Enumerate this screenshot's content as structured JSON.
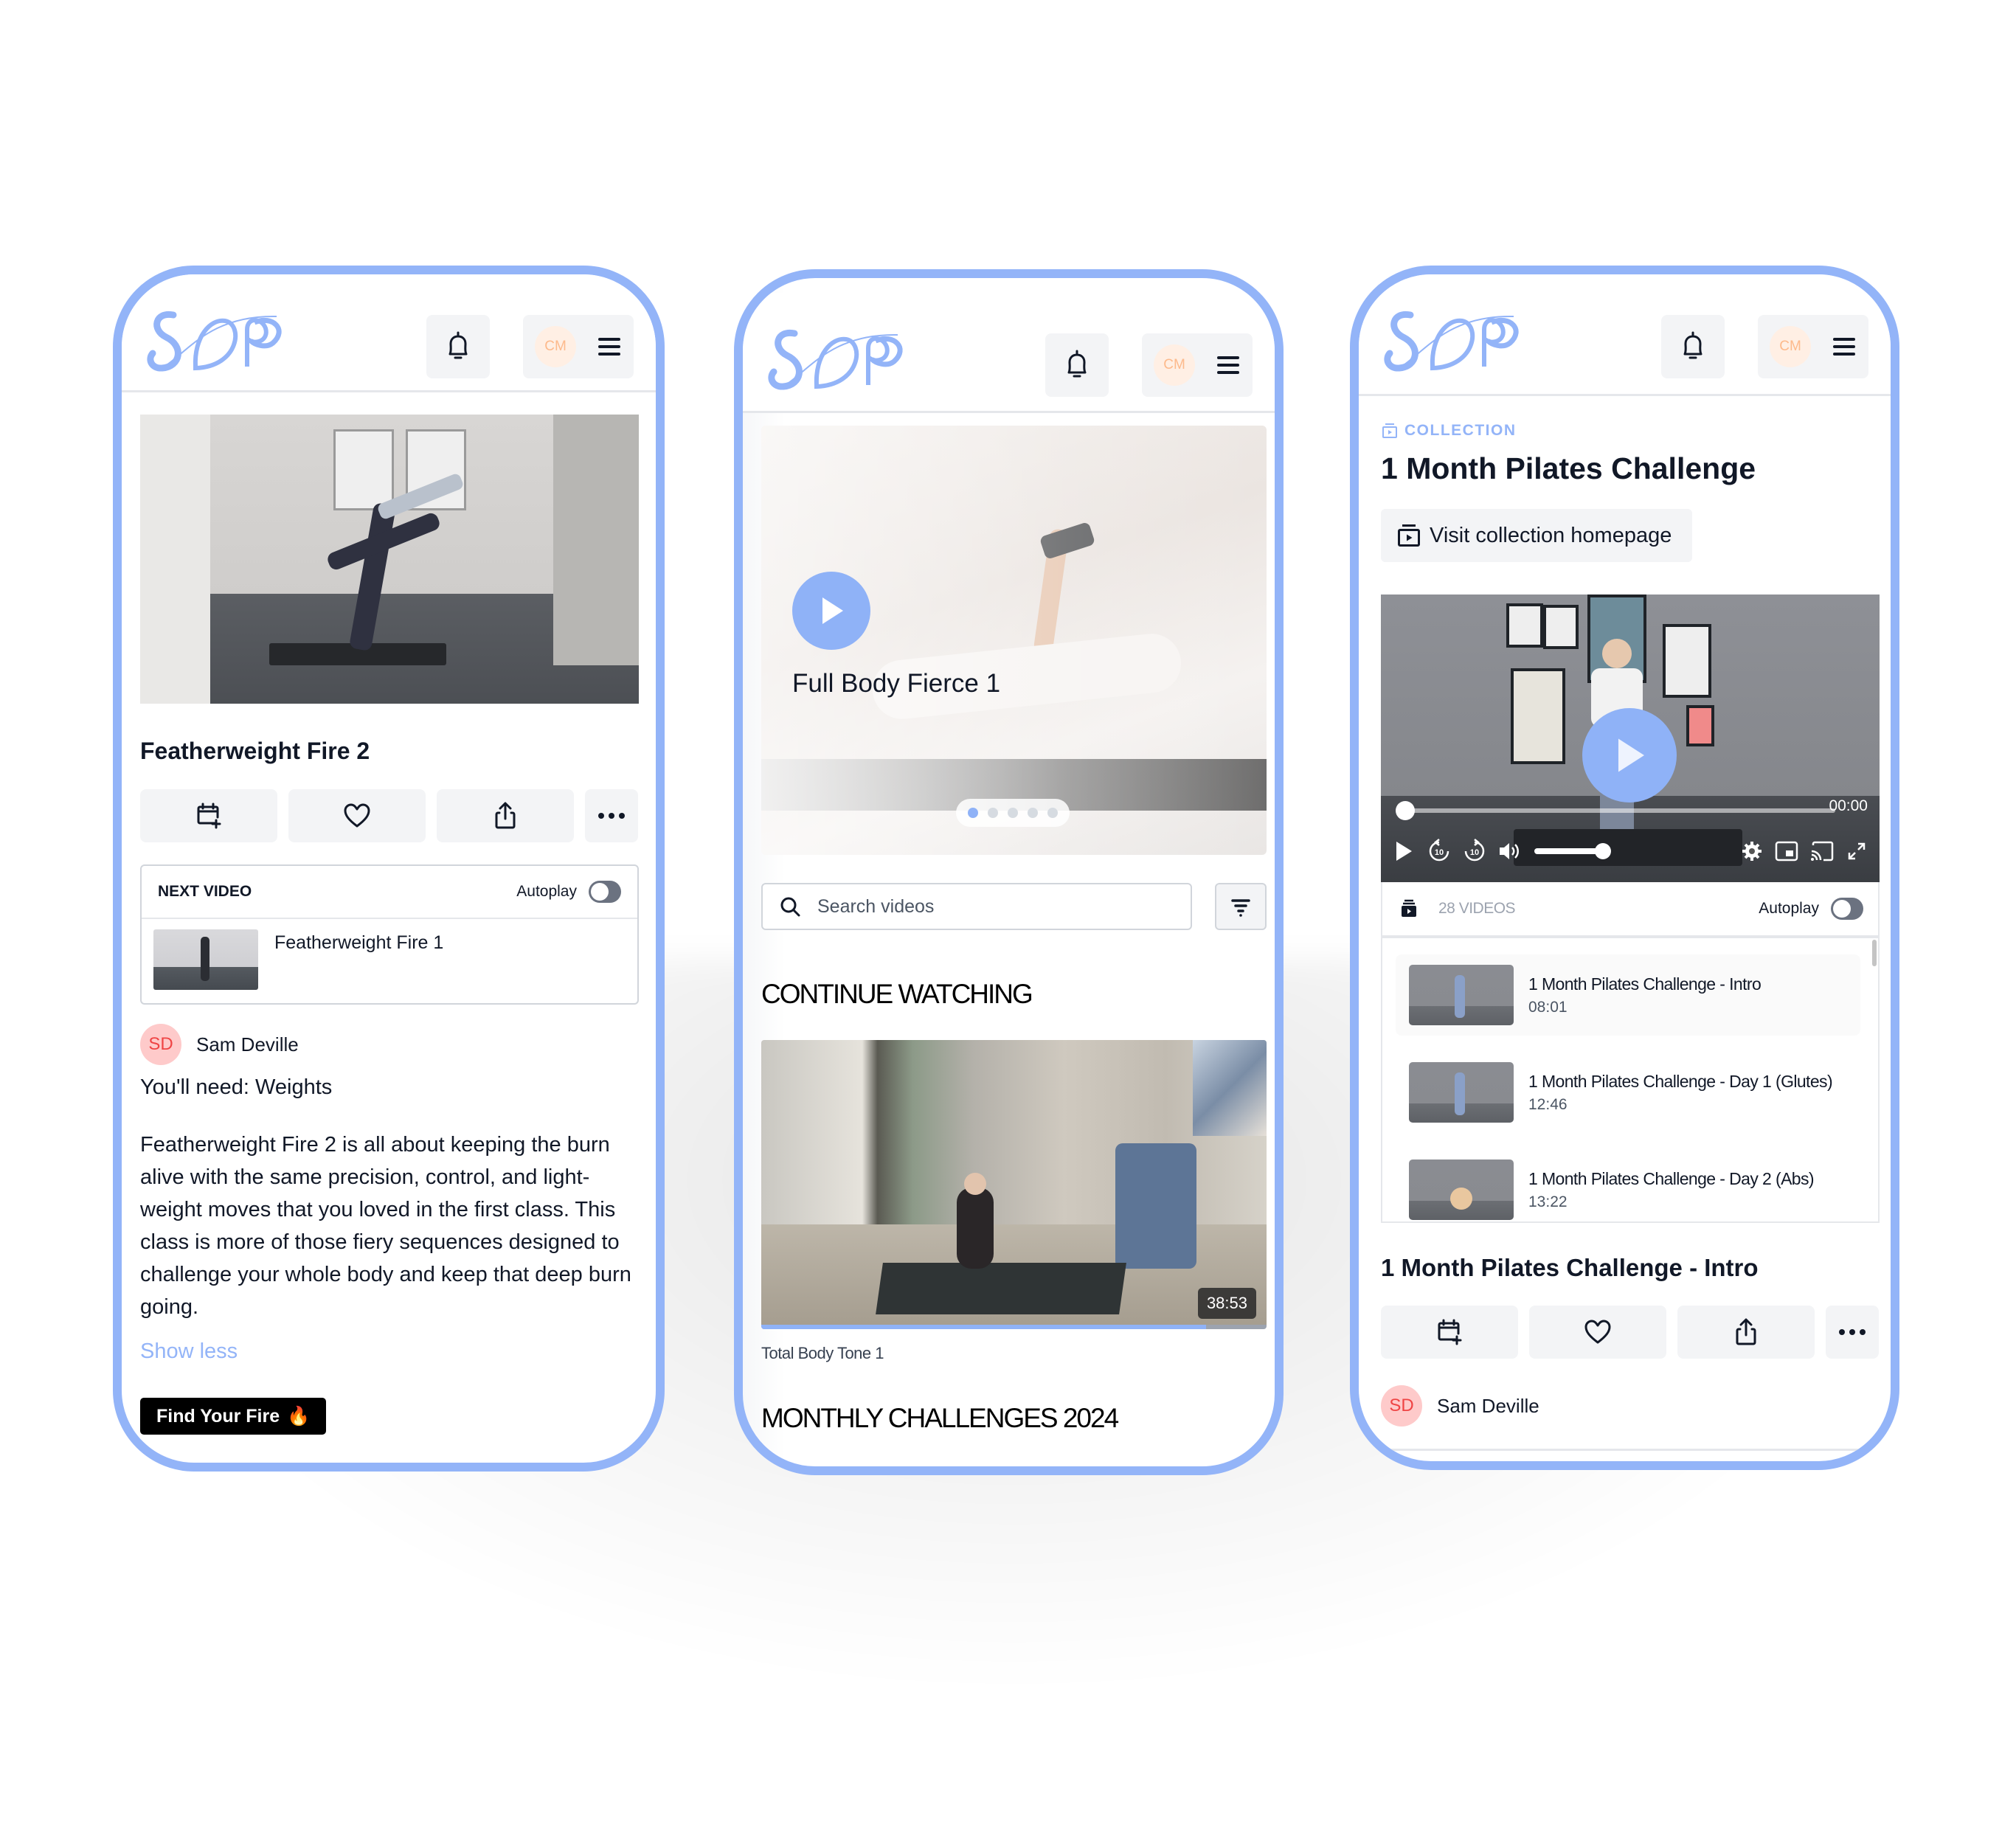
{
  "brand": {
    "logo_text": "SDP",
    "accent_color": "#93b4f8",
    "avatar_initials": "CM"
  },
  "header": {
    "notifications_icon": "bell-icon",
    "menu_icon": "hamburger-menu-icon"
  },
  "phone1": {
    "video_title": "Featherweight Fire 2",
    "actions": [
      {
        "icon": "calendar-add-icon",
        "label": "Schedule"
      },
      {
        "icon": "heart-icon",
        "label": "Favourite"
      },
      {
        "icon": "share-icon",
        "label": "Share"
      },
      {
        "icon": "more-horizontal-icon",
        "label": "More"
      }
    ],
    "next_video": {
      "heading": "NEXT VIDEO",
      "autoplay_label": "Autoplay",
      "autoplay_on": false,
      "title": "Featherweight Fire 1"
    },
    "author": {
      "initials": "SD",
      "name": "Sam Deville"
    },
    "equipment": "You'll need: Weights",
    "description": "Featherweight Fire 2 is all about keeping the burn alive with the same precision, control, and light-weight moves that you loved in the first class. This class is more of those fiery sequences designed to challenge your whole body and keep that deep burn going.",
    "show_less": "Show less",
    "cta_label": "Find Your Fire",
    "cta_emoji": "🔥"
  },
  "phone2": {
    "hero": {
      "title": "Full Body Fierce 1",
      "play_icon": "play-icon",
      "slides_total": 5,
      "active_slide": 1
    },
    "search": {
      "placeholder": "Search videos",
      "value": ""
    },
    "filter_icon": "filter-icon",
    "continue_watching": {
      "heading": "CONTINUE WATCHING",
      "video_title": "Total Body Tone 1",
      "duration": "38:53",
      "progress_percent": 88
    },
    "monthly_heading": "MONTHLY CHALLENGES 2024"
  },
  "phone3": {
    "collection_label": "COLLECTION",
    "collection_title": "1 Month Pilates Challenge",
    "visit_button": "Visit collection homepage",
    "player": {
      "current_time": "00:00",
      "playback_progress_percent": 0,
      "volume_percent": 100,
      "controls": [
        "play-icon",
        "rewind-10-icon",
        "forward-10-icon",
        "volume-icon",
        "settings-icon",
        "picture-in-picture-icon",
        "cast-icon",
        "fullscreen-icon"
      ]
    },
    "playlist": {
      "count_label": "28 VIDEOS",
      "autoplay_label": "Autoplay",
      "autoplay_on": false,
      "items": [
        {
          "title": "1 Month Pilates Challenge - Intro",
          "duration": "08:01",
          "active": true
        },
        {
          "title": "1 Month Pilates Challenge - Day 1 (Glutes)",
          "duration": "12:46",
          "active": false
        },
        {
          "title": "1 Month Pilates Challenge - Day 2 (Abs)",
          "duration": "13:22",
          "active": false
        }
      ]
    },
    "current_video_title": "1 Month Pilates Challenge - Intro",
    "author": {
      "initials": "SD",
      "name": "Sam Deville"
    }
  }
}
